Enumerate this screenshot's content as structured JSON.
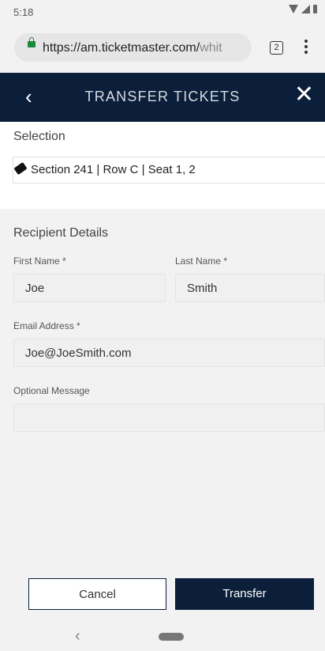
{
  "status": {
    "time": "5:18"
  },
  "browser": {
    "url_main": "https://am.ticketmaster.com/",
    "url_dim": "whit",
    "tab_count": "2"
  },
  "header": {
    "title": "TRANSFER TICKETS",
    "back": "‹",
    "close": "✕"
  },
  "selection": {
    "label": "Selection",
    "value": "Section 241 | Row C | Seat 1, 2"
  },
  "recipient": {
    "heading": "Recipient Details",
    "first_name_label": "First Name *",
    "first_name_value": "Joe",
    "last_name_label": "Last Name *",
    "last_name_value": "Smith",
    "email_label": "Email Address *",
    "email_value": "Joe@JoeSmith.com",
    "message_label": "Optional Message",
    "message_value": ""
  },
  "actions": {
    "cancel": "Cancel",
    "transfer": "Transfer"
  },
  "nav": {
    "back": "‹"
  },
  "colors": {
    "brand_navy": "#0b1f3a",
    "lock_green": "#1a8b3c"
  }
}
